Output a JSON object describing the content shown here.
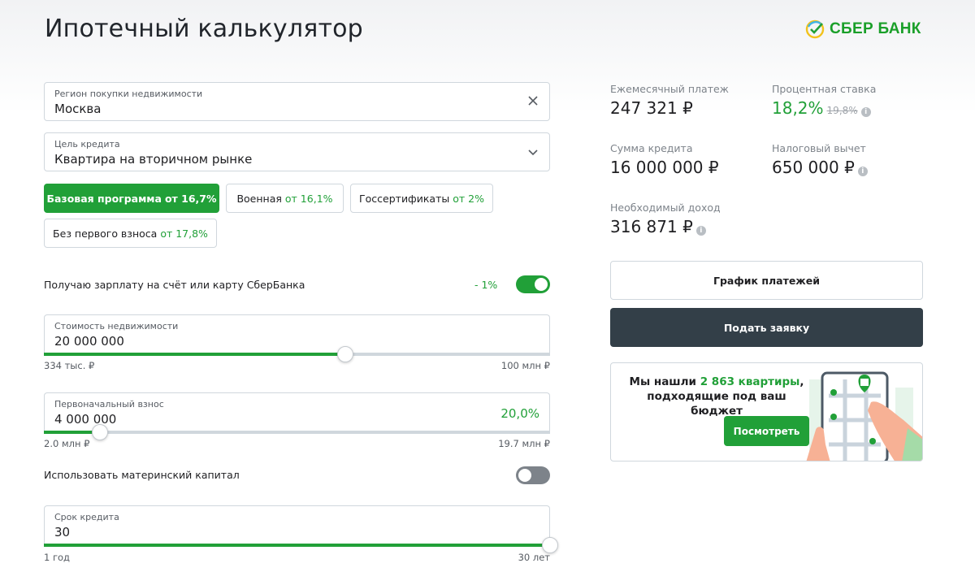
{
  "header": {
    "title": "Ипотечный калькулятор",
    "logo_text": "СБЕР БАНК"
  },
  "region": {
    "label": "Регион покупки недвижимости",
    "value": "Москва"
  },
  "purpose": {
    "label": "Цель кредита",
    "value": "Квартира на вторичном рынке"
  },
  "programs": [
    {
      "name": "Базовая программа",
      "rate": "от 16,7%",
      "active": true
    },
    {
      "name": "Военная",
      "rate": "от 16,1%",
      "active": false
    },
    {
      "name": "Госсертификаты",
      "rate": "от 2%",
      "active": false
    },
    {
      "name": "Без первого взноса",
      "rate": "от 17,8%",
      "active": false
    }
  ],
  "salary": {
    "label": "Получаю зарплату на счёт или карту СберБанка",
    "discount": "- 1%",
    "enabled": true
  },
  "property_cost": {
    "label": "Стоимость недвижимости",
    "value": "20 000 000",
    "min": "334 тыс. ₽",
    "max": "100 млн ₽",
    "position": 0.595
  },
  "down_payment": {
    "label": "Первоначальный взнос",
    "value": "4 000 000",
    "percent": "20,0%",
    "min": "2.0 млн ₽",
    "max": "19.7 млн ₽",
    "position": 0.11
  },
  "maternity": {
    "label": "Использовать материнский капитал",
    "enabled": false
  },
  "term": {
    "label": "Срок кредита",
    "value": "30",
    "min": "1 год",
    "max": "30 лет",
    "position": 1.0
  },
  "results": {
    "monthly_label": "Ежемесячный платеж",
    "monthly_value": "247 321 ₽",
    "rate_label": "Процентная ставка",
    "rate_value": "18,2%",
    "rate_old": "19,8%",
    "loan_label": "Сумма кредита",
    "loan_value": "16 000 000 ₽",
    "tax_label": "Налоговый вычет",
    "tax_value": "650 000 ₽",
    "income_label": "Необходимый доход",
    "income_value": "316 871 ₽"
  },
  "buttons": {
    "schedule": "График платежей",
    "apply": "Подать заявку"
  },
  "promo": {
    "line1_prefix": "Мы нашли ",
    "line1_highlight": "2 863 квартиры",
    "line1_suffix": ",",
    "line2": "подходящие под ваш бюджет",
    "button": "Посмотреть"
  },
  "colors": {
    "accent": "#21a038",
    "dark_button": "#333f48",
    "border": "#d0d7dd"
  }
}
